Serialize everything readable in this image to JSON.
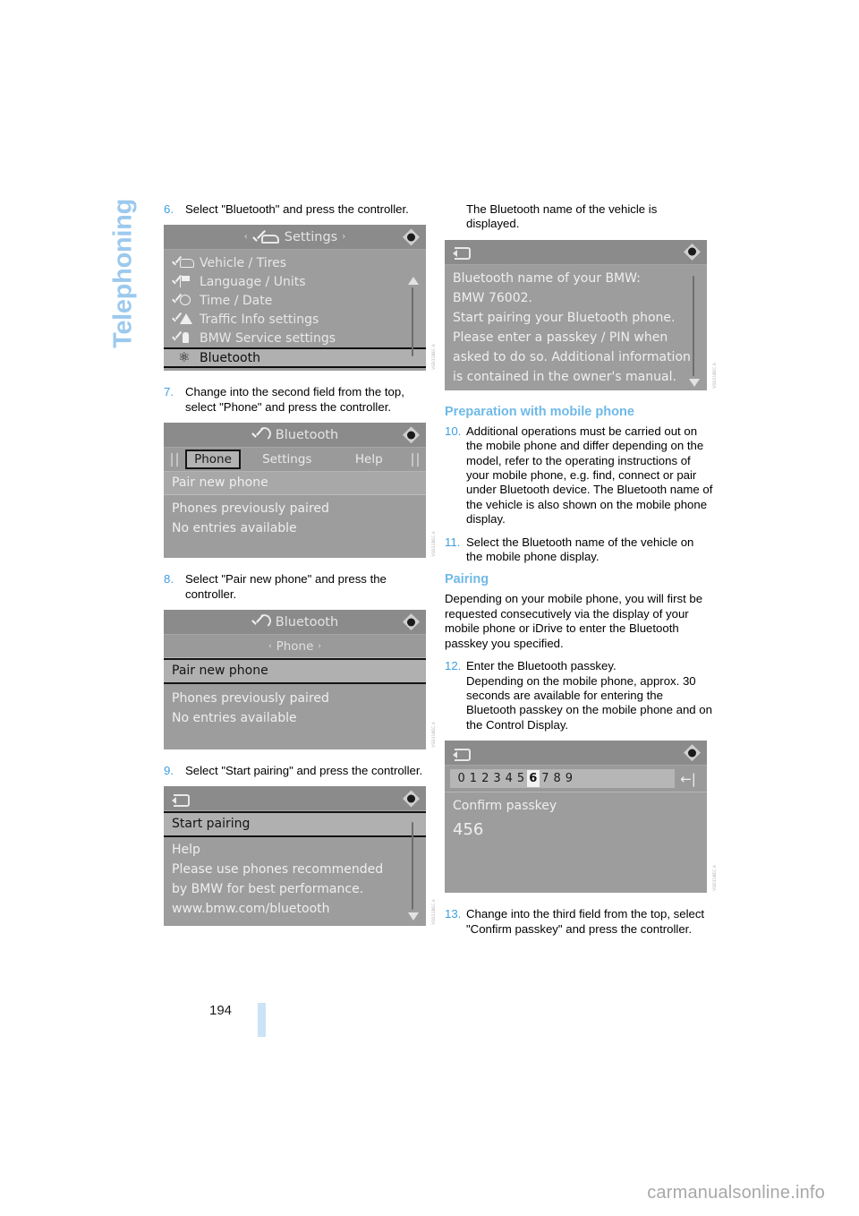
{
  "chapter": "Telephoning",
  "page_number": "194",
  "watermark": "carmanualsonline.info",
  "left_column": {
    "step6": {
      "num": "6.",
      "text": "Select \"Bluetooth\" and press the controller."
    },
    "settings_screen": {
      "title": "Settings",
      "title_icon": "car-check-icon",
      "left_arrow": "‹",
      "right_arrow": "›",
      "knob_icon": "controller-knob-icon",
      "items": [
        {
          "label": "Vehicle / Tires",
          "icon": "check-car-icon"
        },
        {
          "label": "Language / Units",
          "icon": "check-flag-icon"
        },
        {
          "label": "Time / Date",
          "icon": "check-clock-icon"
        },
        {
          "label": "Traffic Info settings",
          "icon": "check-warning-icon"
        },
        {
          "label": "BMW Service settings",
          "icon": "check-service-icon"
        },
        {
          "label": "Bluetooth",
          "icon": "bluetooth-icon",
          "selected": true
        }
      ],
      "ref_code": "VSD31BEC.A"
    },
    "step7": {
      "num": "7.",
      "text": "Change into the second field from the top, select \"Phone\" and press the controller."
    },
    "bluetooth_phone_screen": {
      "title": "Bluetooth",
      "title_icon": "bluetooth-check-icon",
      "knob_icon": "controller-knob-icon",
      "tabs": [
        {
          "label": "Phone",
          "selected": true
        },
        {
          "label": "Settings",
          "selected": false
        },
        {
          "label": "Help",
          "selected": false
        }
      ],
      "rows": [
        {
          "label": "Pair new phone",
          "style": "band"
        },
        {
          "label": "Phones previously paired",
          "style": "plain"
        },
        {
          "label": "No entries available",
          "style": "plain"
        }
      ],
      "ref_code": "VSD31BEC.A"
    },
    "step8": {
      "num": "8.",
      "text": "Select \"Pair new phone\" and press the controller."
    },
    "pair_new_phone_screen": {
      "title": "Bluetooth",
      "title_icon": "bluetooth-check-icon",
      "knob_icon": "controller-knob-icon",
      "subhead": "Phone",
      "left_arrow": "‹",
      "right_arrow": "›",
      "rows": [
        {
          "label": "Pair new phone",
          "style": "highlight"
        },
        {
          "label": "Phones previously paired",
          "style": "plain"
        },
        {
          "label": "No entries available",
          "style": "plain"
        }
      ],
      "ref_code": "VSD31BEC.A"
    },
    "step9": {
      "num": "9.",
      "text": "Select \"Start pairing\" and press the controller."
    },
    "start_pairing_screen": {
      "back_icon": "back-arrow-icon",
      "knob_icon": "controller-knob-icon",
      "rows": [
        {
          "label": "Start pairing",
          "style": "highlight"
        },
        {
          "label": "Help",
          "style": "plain"
        },
        {
          "label": "Please use phones recommended",
          "style": "plain"
        },
        {
          "label": "by BMW for best performance.",
          "style": "plain"
        },
        {
          "label": "www.bmw.com/bluetooth",
          "style": "plain"
        }
      ],
      "ref_code": "VSD31BEC.A"
    }
  },
  "right_column": {
    "intro": "The Bluetooth name of the vehicle is displayed.",
    "bt_name_screen": {
      "back_icon": "back-arrow-icon",
      "knob_icon": "controller-knob-icon",
      "lines": [
        "Bluetooth name of your BMW:",
        "BMW 76002.",
        "Start pairing your Bluetooth phone.",
        "Please enter a passkey / PIN when",
        "asked to do so. Additional information",
        "is contained in the owner's manual."
      ],
      "ref_code": "VSD31BEC.A"
    },
    "prep_heading": "Preparation with mobile phone",
    "step10": {
      "num": "10.",
      "text": "Additional operations must be carried out on the mobile phone and differ depending on the model, refer to the operating instructions of your mobile phone, e.g. find, connect or pair under Bluetooth device. The Bluetooth name of the vehicle is also shown on the mobile phone display."
    },
    "step11": {
      "num": "11.",
      "text": "Select the Bluetooth name of the vehicle on the mobile phone display."
    },
    "pairing_heading": "Pairing",
    "pairing_intro": "Depending on your mobile phone, you will first be requested consecutively via the display of your mobile phone or iDrive to enter the Bluetooth passkey you specified.",
    "step12": {
      "num": "12.",
      "text": "Enter the Bluetooth passkey."
    },
    "step12_cont": "Depending on the mobile phone, approx. 30 seconds are available for entering the Bluetooth passkey on the mobile phone and on the Control Display.",
    "passkey_screen": {
      "back_icon": "back-arrow-icon",
      "knob_icon": "controller-knob-icon",
      "keys": [
        "0",
        "1",
        "2",
        "3",
        "4",
        "5",
        "6",
        "7",
        "8",
        "9"
      ],
      "selected_key": "6",
      "delete_icon": "backspace-icon",
      "prompt": "Confirm passkey",
      "value": "456",
      "ref_code": "VSD31BEC.A"
    },
    "step13": {
      "num": "13.",
      "text": "Change into the third field from the top, select \"Confirm passkey\" and press the controller."
    }
  }
}
